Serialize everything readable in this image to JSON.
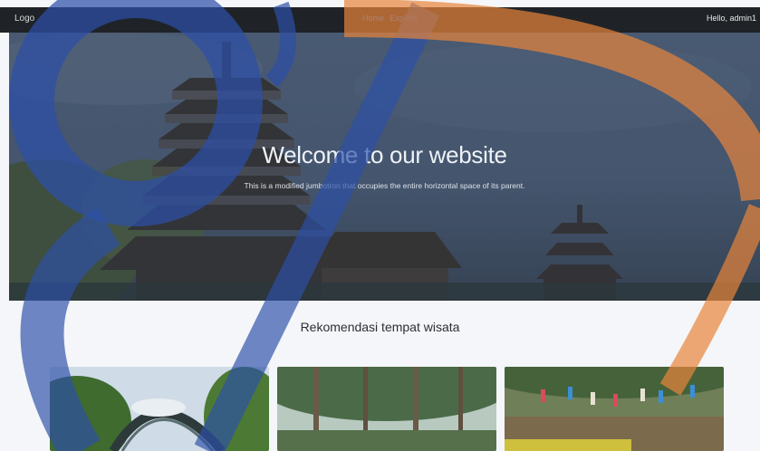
{
  "navbar": {
    "logo": "Logo",
    "links": [
      "Home",
      "Explore"
    ],
    "user_greeting": "Hello, admin1"
  },
  "hero": {
    "title": "Welcome to our website",
    "subtitle": "This is a modified jumbotron that occupies the entire horizontal space of its parent."
  },
  "section": {
    "title": "Rekomendasi tempat wisata"
  },
  "cards": [
    {
      "image": "park-arch-photo"
    },
    {
      "image": "pine-forest-photo"
    },
    {
      "image": "outdoor-activity-photo"
    }
  ],
  "colors": {
    "navbar_bg": "#1f2327",
    "link": "#2e7cf6",
    "watermark_blue": "#2c4fa8",
    "watermark_orange": "#e8843a"
  }
}
